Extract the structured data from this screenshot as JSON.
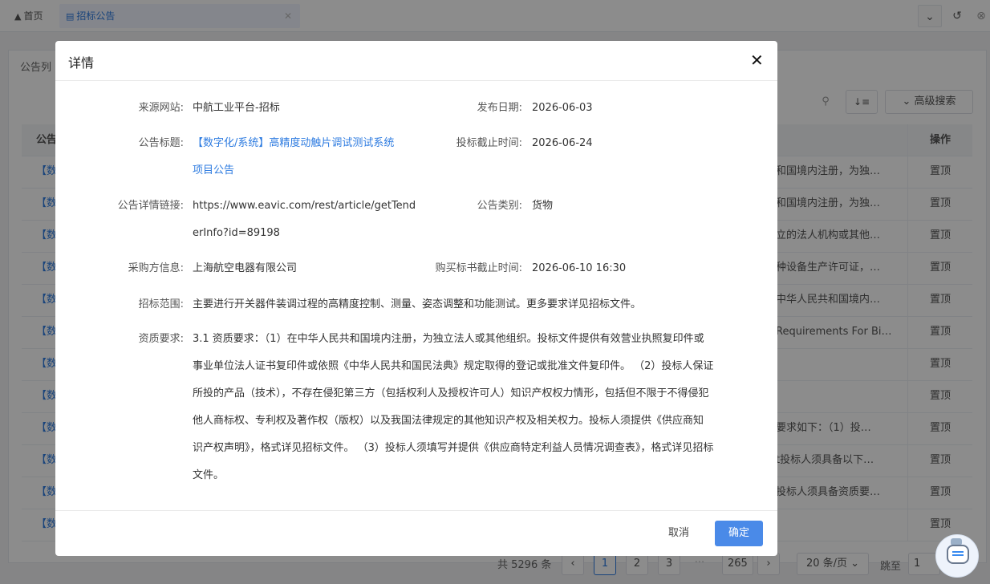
{
  "tabs": [
    {
      "label": "首页",
      "icon": "home-icon"
    },
    {
      "label": "招标公告",
      "icon": "calendar-icon"
    }
  ],
  "page": {
    "list_title": "公告列",
    "advanced_search": "高级搜索",
    "col_first": "公告",
    "col_op": "操作"
  },
  "rows": [
    {
      "prefix": "【数",
      "excerpt": "和国境内注册，为独…",
      "op": "置顶"
    },
    {
      "prefix": "【数",
      "excerpt": "和国境内注册，为独…",
      "op": "置顶"
    },
    {
      "prefix": "【数",
      "excerpt": "立的法人机构或其他…",
      "op": "置顶"
    },
    {
      "prefix": "【数",
      "excerpt": "种设备生产许可证，…",
      "op": "置顶"
    },
    {
      "prefix": "【数",
      "excerpt": "中华人民共和国境内…",
      "op": "置顶"
    },
    {
      "prefix": "【数",
      "excerpt": "Requirements For Bi…",
      "op": "置顶"
    },
    {
      "prefix": "【数",
      "excerpt": "",
      "op": "置顶"
    },
    {
      "prefix": "【数",
      "excerpt": "",
      "op": "置顶"
    },
    {
      "prefix": "【数",
      "excerpt": "要求如下：（1）投…",
      "op": "置顶"
    },
    {
      "prefix": "【数",
      "excerpt": "t投标人须具备以下…",
      "op": "置顶"
    },
    {
      "prefix": "【数",
      "excerpt": "投标人须具备资质要…",
      "op": "置顶"
    },
    {
      "prefix": "【数",
      "excerpt": "",
      "op": "置顶"
    }
  ],
  "pager": {
    "total": "共 5296 条",
    "pages": [
      "1",
      "2",
      "3",
      "···",
      "265"
    ],
    "page_size": "20 条/页",
    "jump_label": "跳至",
    "jump_value": "1"
  },
  "modal": {
    "title": "详情",
    "fields": {
      "source_label": "来源网站:",
      "source_value": "中航工业平台-招标",
      "publish_label": "发布日期:",
      "publish_value": "2026-06-03",
      "title_label": "公告标题:",
      "title_line1": "【数字化/系统】高精度动触片调试测试系统",
      "title_line2": "项目公告",
      "deadline_label": "投标截止时间:",
      "deadline_value": "2026-06-24",
      "link_label": "公告详情链接:",
      "link_line1": "https://www.eavic.com/rest/article/getTend",
      "link_line2": "erInfo?id=89198",
      "category_label": "公告类别:",
      "category_value": "货物",
      "buyer_label": "采购方信息:",
      "buyer_value": "上海航空电器有限公司",
      "doc_deadline_label": "购买标书截止时间:",
      "doc_deadline_value": "2026-06-10 16:30",
      "scope_label": "招标范围:",
      "scope_value": "主要进行开关器件装调过程的高精度控制、测量、姿态调整和功能测试。更多要求详见招标文件。",
      "qual_label": "资质要求:",
      "qual_lines": [
        "3.1 资质要求：（1）在中华人民共和国境内注册，为独立法人或其他组织。投标文件提供有效营业执照复印件或",
        "事业单位法人证书复印件或依照《中华人民共和国民法典》规定取得的登记或批准文件复印件。 （2）投标人保证",
        "所投的产品（技术），不存在侵犯第三方（包括权利人及授权许可人）知识产权权力情形，包括但不限于不得侵犯",
        "他人商标权、专利权及著作权（版权）以及我国法律规定的其他知识产权及相关权力。投标人须提供《供应商知",
        "识产权声明》，格式详见招标文件。 （3）投标人须填写并提供《供应商特定利益人员情况调查表》，格式详见招标",
        "文件。"
      ]
    },
    "cancel": "取消",
    "confirm": "确定"
  }
}
